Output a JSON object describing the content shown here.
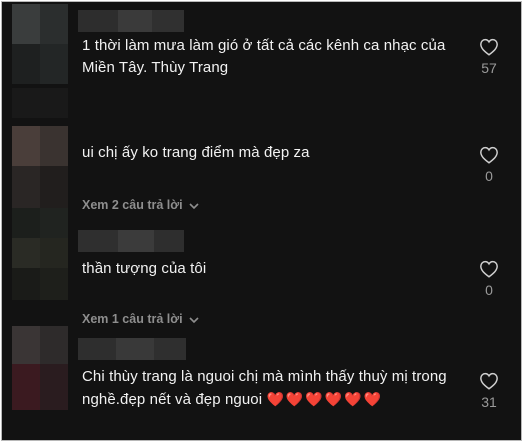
{
  "comments": [
    {
      "text": "1 thời làm mưa làm gió ở tất cả các kênh ca nhạc của Miền Tây. Thùy Trang",
      "likes": "57",
      "replies_label": ""
    },
    {
      "text": "ui chị ấy ko trang điểm mà đẹp za",
      "likes": "0",
      "replies_label": "Xem 2 câu trả lời"
    },
    {
      "text": "thần tượng của tôi",
      "likes": "0",
      "replies_label": "Xem 1 câu trả lời"
    },
    {
      "text": "Chi thùy trang là nguoi chị mà mình thấy thuỳ mị trong nghề.đẹp nết và đẹp nguoi",
      "emoji": "❤️❤️❤️❤️❤️❤️",
      "likes": "31",
      "replies_label": ""
    }
  ],
  "icons": {
    "like": "heart-outline-icon",
    "expand": "chevron-down-icon"
  },
  "colors": {
    "background": "#121212",
    "text": "#f2f2f2",
    "muted": "#8e8e8e",
    "heart_emoji": "#e8233a"
  }
}
